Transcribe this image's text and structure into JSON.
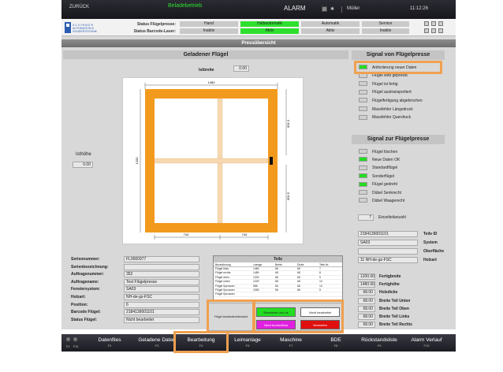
{
  "top": {
    "left_label": "ZURÜCK",
    "mode": "Beladebetrieb",
    "alarm": "ALARM",
    "user": "Müller",
    "time": "11:12:26"
  },
  "status": {
    "row1_label": "Status Flügelpresse:",
    "row2_label": "Status Barcode-Laser:",
    "row1": [
      "Hand",
      "Halbautomatik",
      "Automatik",
      "Service"
    ],
    "row2": [
      "Inaktiv",
      "Aktiv",
      "Aktiv",
      "Inaktiv"
    ],
    "logo_line1": "S C H I R M E R",
    "logo_line2": "AUTOMATION &",
    "logo_line3": "SONDERTECHNIK"
  },
  "page_title": "Pressübersicht",
  "center": {
    "header": "Geladener Flügel",
    "istbreite_label": "Istbreite",
    "istbreite_value": "0.00",
    "isthoehe_label": "Isthöhe",
    "isthoehe_value": "0.00",
    "dim_top": "1480",
    "dim_left": "1200",
    "dim_right_upper": "601.5",
    "dim_right_lower": "601.5",
    "dim_bottom_left": "744",
    "dim_bottom_right": "744"
  },
  "right_panel": {
    "header_top": "Signal von Flügelpresse",
    "signals_out": [
      {
        "label": "Anforderung neuer Daten",
        "active": true
      },
      {
        "label": "Flügel wird gepresst",
        "active": false
      },
      {
        "label": "Flügel ist fertig",
        "active": false
      },
      {
        "label": "Flügel austransportiert",
        "active": false
      },
      {
        "label": "Flügelfertigung abgebrochen",
        "active": false
      },
      {
        "label": "Massfehler Längsdruck",
        "active": false
      },
      {
        "label": "Massfehler Querdruck",
        "active": false
      }
    ],
    "header_mid": "Signal zur Flügelpresse",
    "signals_in": [
      {
        "label": "Flügel löschen",
        "active": false
      },
      {
        "label": "Neue Daten OK",
        "active": true
      },
      {
        "label": "Standardflügel",
        "active": false
      },
      {
        "label": "Sonderflügel",
        "active": true
      },
      {
        "label": "Flügel gedreht",
        "active": true
      },
      {
        "label": "Dübel Senkrecht",
        "active": false
      },
      {
        "label": "Dübel Waagerecht",
        "active": false
      }
    ],
    "einzelteil_count": "7",
    "einzelteil_label": "Einzelteilanzahl",
    "info_rows": [
      {
        "value": "2184139001101",
        "label": "Teile ID"
      },
      {
        "value": "SA03",
        "label": "System"
      },
      {
        "value": "",
        "label": "Oberfläche"
      },
      {
        "value": "11   NH-de-gz-FSC",
        "label": "Holzart"
      }
    ],
    "measure_rows": [
      {
        "value": "1200.00",
        "label": "Fertigbreite"
      },
      {
        "value": "1480.00",
        "label": "Fertighöhe"
      },
      {
        "value": "68.00",
        "label": "Holzdicke"
      },
      {
        "value": "68.00",
        "label": "Breite Teil Unten"
      },
      {
        "value": "68.00",
        "label": "Breite Teil Oben"
      },
      {
        "value": "68.00",
        "label": "Breite Teil Links"
      },
      {
        "value": "68.00",
        "label": "Breite Teil Rechts"
      }
    ]
  },
  "left_info": [
    {
      "label": "Seriennummer:",
      "value": "FL0000977"
    },
    {
      "label": "Serienbezeichnung:",
      "value": ""
    },
    {
      "label": "Auftragsnummer:",
      "value": "352"
    },
    {
      "label": "Auftragsname:",
      "value": "Test Flügelpresse"
    },
    {
      "label": "Fenstersystem:",
      "value": "SA03"
    },
    {
      "label": "Holzart:",
      "value": "NH-de-gz-FSC"
    },
    {
      "label": "Position:",
      "value": "6"
    },
    {
      "label": "Barcode Flügel:",
      "value": "2184139001101"
    },
    {
      "label": "Status Flügel:",
      "value": "Nicht bearbeitet"
    }
  ],
  "parts": {
    "title": "Teile",
    "columns": [
      "Bezeichnung",
      "Laenge",
      "Breite",
      "Dicke",
      "Teile Nr."
    ],
    "rows": [
      [
        "Flügel links",
        "1480",
        "68",
        "68",
        "7"
      ],
      [
        "Flügel rechts",
        "1480",
        "68",
        "68",
        "8"
      ],
      [
        "Flügel oben",
        "1200",
        "68",
        "68",
        "9"
      ],
      [
        "Flügel unten",
        "1200",
        "68",
        "68",
        "10"
      ],
      [
        "Flügel Sprossen",
        "586",
        "56",
        "68",
        "10"
      ],
      [
        "Flügel Sprossen",
        "1083",
        "56",
        "68",
        "5"
      ],
      [
        "Flügel Sprossen",
        "",
        "",
        "",
        ""
      ]
    ]
  },
  "process": {
    "label": "Flügel bearbeitenübersicht",
    "btn1": "Bearbeitet und ok",
    "btn2": "Nicht bearbeitet",
    "btn3": "Nicht bearbeitbar",
    "btn4": "Verworfen"
  },
  "fbuttons": [
    {
      "label": "Datenfiles",
      "key": "F2"
    },
    {
      "label": "Geladene Daten",
      "key": "F3"
    },
    {
      "label": "Bearbeitung",
      "key": "F4"
    },
    {
      "label": "Leimanlage",
      "key": "F5"
    },
    {
      "label": "Maschine",
      "key": "F7"
    },
    {
      "label": "BDE",
      "key": "F8"
    },
    {
      "label": "Rückstandsliste",
      "key": "F9"
    },
    {
      "label": "Alarm Verlauf",
      "key": "F10"
    }
  ],
  "fbutton_left": {
    "k1": "F1",
    "k2": "F11"
  },
  "colors": {
    "frame": "#f29a1e",
    "green": "#22dd22",
    "highlight": "#f0a050"
  }
}
